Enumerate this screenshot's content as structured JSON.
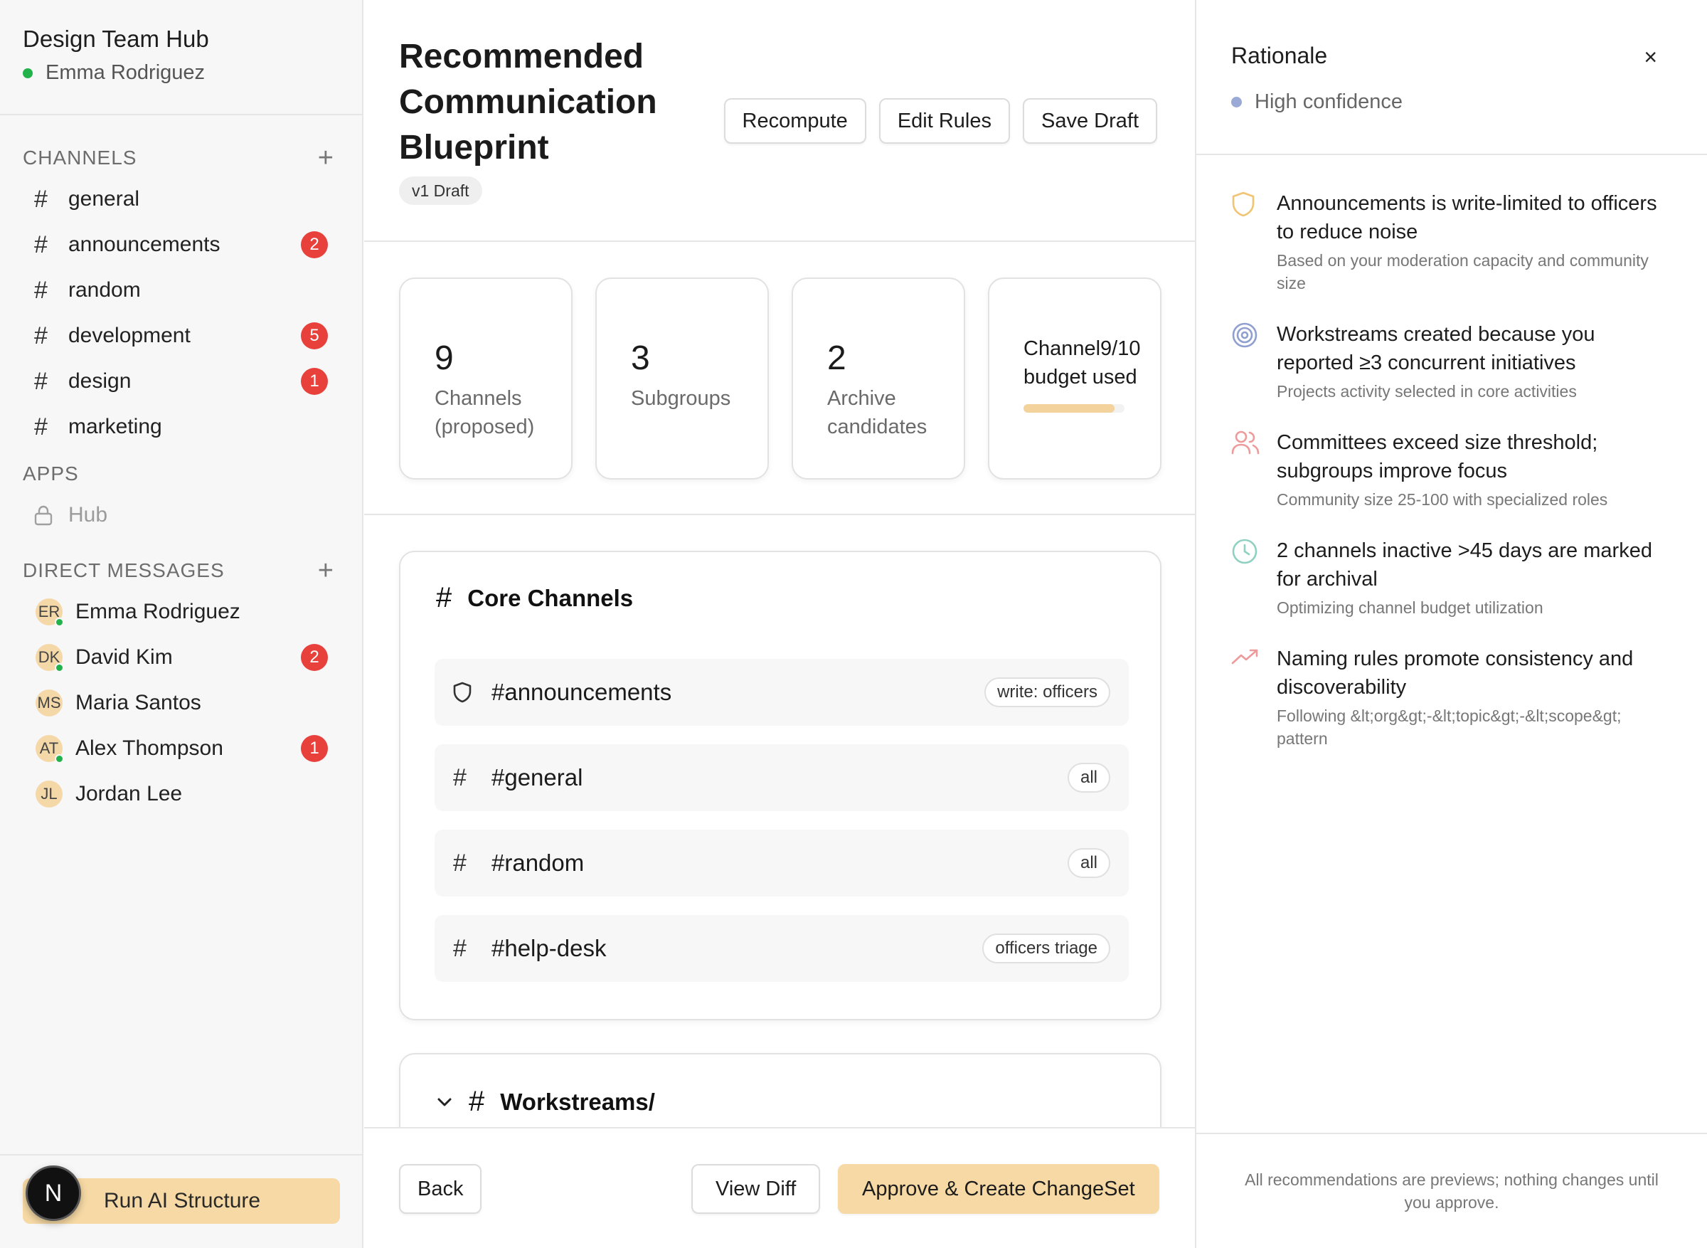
{
  "workspace": {
    "name": "Design Team Hub",
    "user": "Emma Rodriguez",
    "status_color": "#22b24c"
  },
  "sidebar": {
    "channels_label": "CHANNELS",
    "channels": [
      {
        "name": "general",
        "badge": ""
      },
      {
        "name": "announcements",
        "badge": "2"
      },
      {
        "name": "random",
        "badge": ""
      },
      {
        "name": "development",
        "badge": "5"
      },
      {
        "name": "design",
        "badge": "1"
      },
      {
        "name": "marketing",
        "badge": ""
      }
    ],
    "apps_label": "APPS",
    "apps": [
      {
        "name": "Hub",
        "icon": "lock-icon"
      }
    ],
    "dm_label": "DIRECT MESSAGES",
    "dms": [
      {
        "initials": "ER",
        "name": "Emma Rodriguez",
        "online": true,
        "badge": ""
      },
      {
        "initials": "DK",
        "name": "David Kim",
        "online": true,
        "badge": "2"
      },
      {
        "initials": "MS",
        "name": "Maria Santos",
        "online": false,
        "badge": ""
      },
      {
        "initials": "AT",
        "name": "Alex Thompson",
        "online": true,
        "badge": "1"
      },
      {
        "initials": "JL",
        "name": "Jordan Lee",
        "online": false,
        "badge": ""
      }
    ],
    "logo_letter": "N",
    "run_ai_label": "Run AI Structure"
  },
  "main": {
    "title": "Recommended Communication Blueprint",
    "version": "v1 Draft",
    "actions": {
      "recompute": "Recompute",
      "edit_rules": "Edit Rules",
      "save_draft": "Save Draft"
    },
    "stats": [
      {
        "value": "9",
        "label": "Channels (proposed)"
      },
      {
        "value": "3",
        "label": "Subgroups"
      },
      {
        "value": "2",
        "label": "Archive candidates"
      }
    ],
    "budget": {
      "label": "Channel9/10 budget used",
      "fraction": 0.9,
      "color": "#f3d29c"
    },
    "core": {
      "title": "Core Channels",
      "rows": [
        {
          "name": "#announcements",
          "icon": "shield-icon",
          "tag": "write: officers"
        },
        {
          "name": "#general",
          "icon": "hash-icon",
          "tag": "all"
        },
        {
          "name": "#random",
          "icon": "hash-icon",
          "tag": "all"
        },
        {
          "name": "#help-desk",
          "icon": "hash-icon",
          "tag": "officers triage"
        }
      ]
    },
    "workstreams": {
      "title": "Workstreams/"
    },
    "footer": {
      "back": "Back",
      "view_diff": "View Diff",
      "approve": "Approve & Create ChangeSet"
    },
    "accent": "#f6d9a4"
  },
  "panel": {
    "title": "Rationale",
    "close": "×",
    "confidence": "High confidence",
    "reasons": [
      {
        "icon": "shield-icon",
        "title": "Announcements is write-limited to officers to reduce noise",
        "sub": "Based on your moderation capacity and community size"
      },
      {
        "icon": "target-icon",
        "title": "Workstreams created because you reported ≥3 concurrent initiatives",
        "sub": "Projects activity selected in core activities"
      },
      {
        "icon": "users-icon",
        "title": "Committees exceed size threshold; subgroups improve focus",
        "sub": "Community size 25-100 with specialized roles"
      },
      {
        "icon": "clock-icon",
        "title": "2 channels inactive >45 days are marked for archival",
        "sub": "Optimizing channel budget utilization"
      },
      {
        "icon": "trending-up-icon",
        "title": "Naming rules promote consistency and discoverability",
        "sub": "Following &lt;org&gt;-&lt;topic&gt;-&lt;scope&gt; pattern"
      }
    ],
    "footer": "All recommendations are previews; nothing changes until you approve."
  }
}
